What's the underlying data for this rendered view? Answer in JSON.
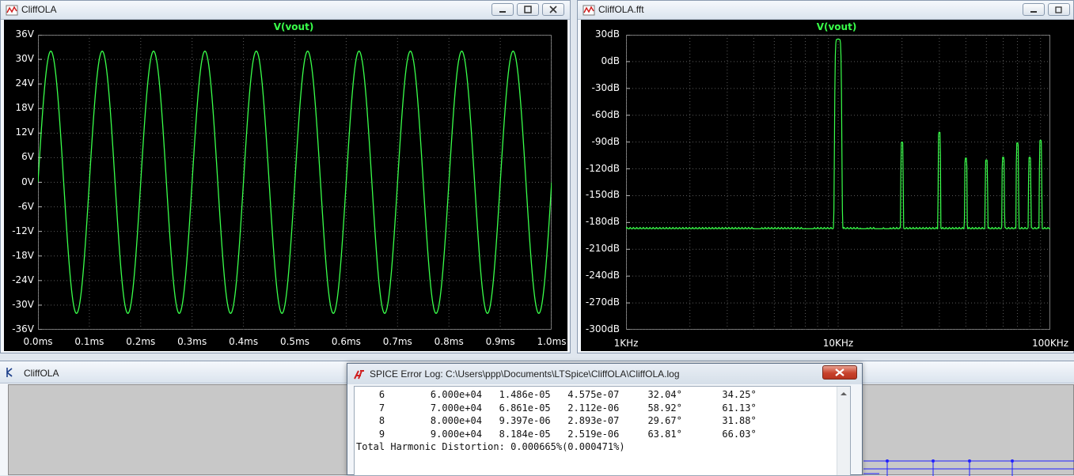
{
  "windows": {
    "transient": {
      "title": "CliffOLA",
      "trace_label": "V(vout)",
      "y_ticks": [
        "36V",
        "30V",
        "24V",
        "18V",
        "12V",
        "6V",
        "0V",
        "-6V",
        "-12V",
        "-18V",
        "-24V",
        "-30V",
        "-36V"
      ],
      "x_ticks": [
        "0.0ms",
        "0.1ms",
        "0.2ms",
        "0.3ms",
        "0.4ms",
        "0.5ms",
        "0.6ms",
        "0.7ms",
        "0.8ms",
        "0.9ms",
        "1.0ms"
      ]
    },
    "fft": {
      "title": "CliffOLA.fft",
      "trace_label": "V(vout)",
      "y_ticks": [
        "30dB",
        "0dB",
        "-30dB",
        "-60dB",
        "-90dB",
        "-120dB",
        "-150dB",
        "-180dB",
        "-210dB",
        "-240dB",
        "-270dB",
        "-300dB"
      ],
      "x_ticks": [
        "1KHz",
        "10KHz",
        "100KHz"
      ]
    },
    "schematic": {
      "title": "CliffOLA"
    },
    "error_log": {
      "title": "SPICE Error Log: C:\\Users\\ppp\\Documents\\LTSpice\\CliffOLA\\CliffOLA.log",
      "lines": [
        "    6        6.000e+04   1.486e-05   4.575e-07     32.04°       34.25°",
        "    7        7.000e+04   6.861e-05   2.112e-06     58.92°       61.13°",
        "    8        8.000e+04   9.397e-06   2.893e-07     29.67°       31.88°",
        "    9        9.000e+04   8.184e-05   2.519e-06     63.81°       66.03°",
        "Total Harmonic Distortion: 0.000665%(0.000471%)"
      ]
    }
  },
  "chart_data": [
    {
      "type": "line",
      "title": "V(vout)",
      "xlabel": "",
      "ylabel": "",
      "x_unit": "ms",
      "y_unit": "V",
      "xlim": [
        0,
        1.0
      ],
      "ylim": [
        -36,
        36
      ],
      "grid": true,
      "series": [
        {
          "name": "V(vout)",
          "amplitude": 32,
          "frequency_khz": 10,
          "cycles": 10,
          "color": "#39ff4a"
        }
      ]
    },
    {
      "type": "line",
      "title": "V(vout)",
      "xlabel": "",
      "ylabel": "",
      "x_scale": "log",
      "x_unit": "Hz",
      "y_unit": "dB",
      "xlim": [
        1000,
        100000
      ],
      "ylim": [
        -300,
        30
      ],
      "grid": true,
      "series": [
        {
          "name": "V(vout)",
          "color": "#39ff4a",
          "noise_floor_db": -187,
          "peaks": [
            {
              "freq_hz": 10000,
              "db": 25
            },
            {
              "freq_hz": 20000,
              "db": -90
            },
            {
              "freq_hz": 30000,
              "db": -79
            },
            {
              "freq_hz": 40000,
              "db": -108
            },
            {
              "freq_hz": 50000,
              "db": -110
            },
            {
              "freq_hz": 60000,
              "db": -107
            },
            {
              "freq_hz": 70000,
              "db": -91
            },
            {
              "freq_hz": 80000,
              "db": -107
            },
            {
              "freq_hz": 90000,
              "db": -88
            }
          ]
        }
      ]
    }
  ],
  "colors": {
    "trace": "#39ff4a",
    "grid": "#5a5a5a",
    "plot_bg": "#000000",
    "axis_text": "#ffffff",
    "wire": "#2020ff"
  },
  "icons": {
    "waveform_window": "waveform-icon",
    "schematic_window": "schematic-icon",
    "log_window": "lt-logo-icon"
  }
}
